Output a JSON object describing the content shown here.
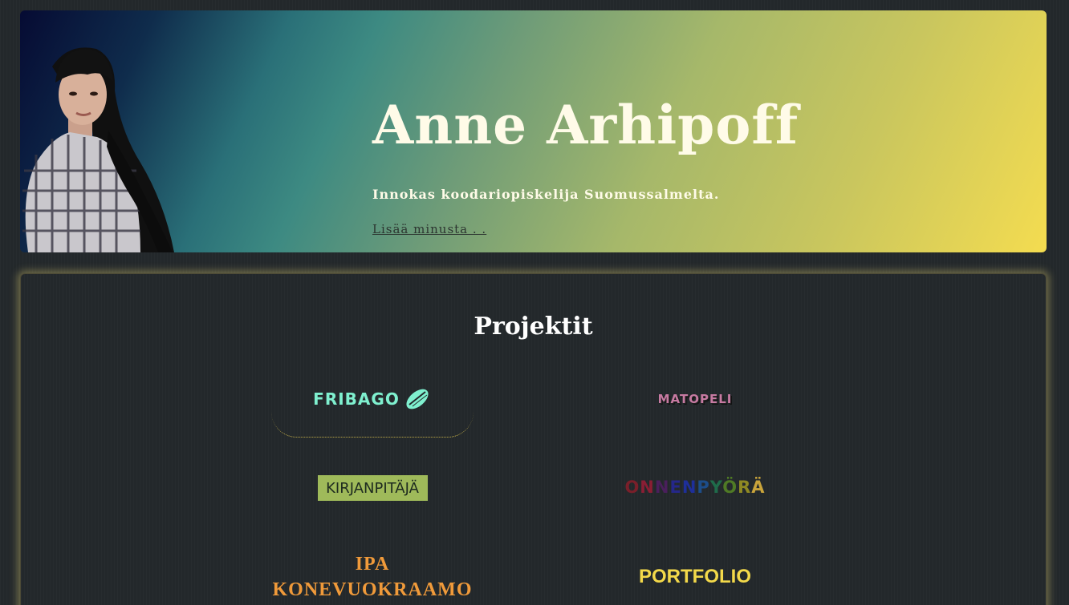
{
  "hero": {
    "name": "Anne Arhipoff",
    "tagline": "Innokas koodariopiskelija Suomussalmelta.",
    "more_link": "Lisää minusta . ."
  },
  "projects": {
    "title": "Projektit",
    "items": [
      {
        "label": "FRIBAGO",
        "icon": "frisbee-icon",
        "color": "#7ff0cf"
      },
      {
        "label": "MATOPELI",
        "color": "#c77aa2"
      },
      {
        "label": "KIRJANPITÄJÄ",
        "color": "#9fba5a"
      },
      {
        "label": "ONNENPYÖRÄ",
        "letters": [
          "O",
          "N",
          "N",
          "E",
          "N",
          "P",
          "Y",
          "Ö",
          "R",
          "Ä"
        ],
        "letter_colors": [
          "#7a1f2a",
          "#8a1e34",
          "#4a1f5c",
          "#25278a",
          "#1e2f9a",
          "#1c4d8a",
          "#1f6b4a",
          "#4f7a25",
          "#8f8a23",
          "#c9a43b"
        ]
      },
      {
        "label": "IPA KONEVUOKRAAMO",
        "line1": "IPA",
        "line2": "KONEVUOKRAAMO",
        "color": "#f09a3a"
      },
      {
        "label": "PORTFOLIO",
        "color": "#f3d94a"
      }
    ]
  }
}
